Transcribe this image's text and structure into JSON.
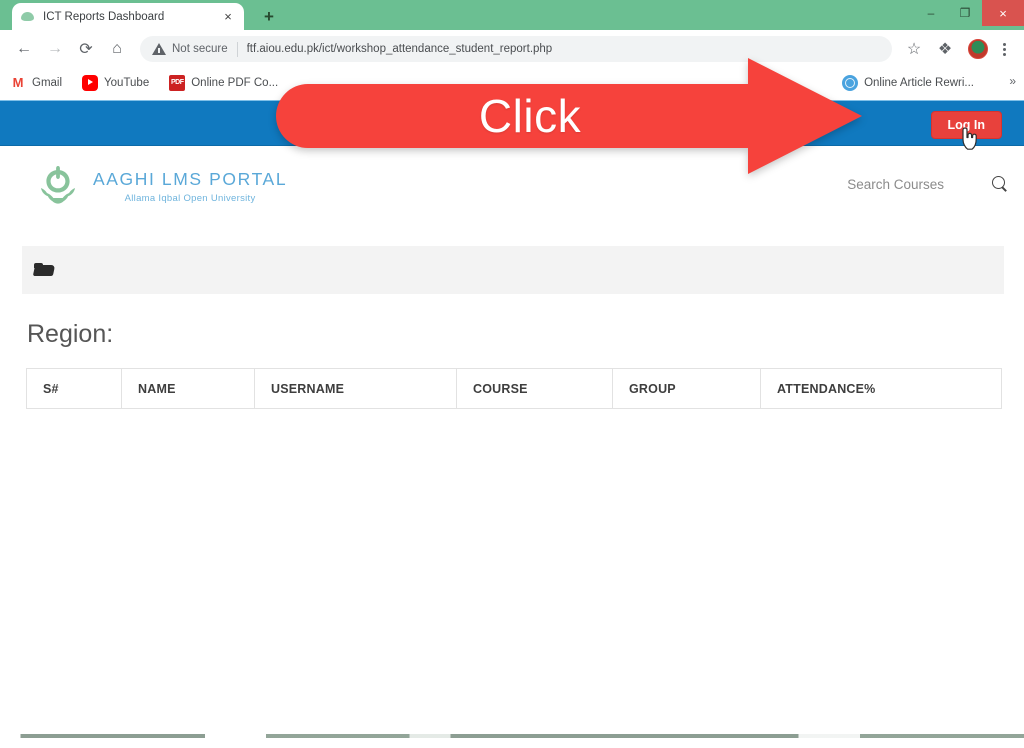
{
  "browser": {
    "tab": {
      "title": "ICT Reports Dashboard",
      "favicon": "aiou-leaf-icon",
      "close_label": "×"
    },
    "new_tab_label": "+",
    "window_controls": {
      "minimize": "–",
      "maximize": "❐",
      "close": "×"
    },
    "toolbar": {
      "back": "←",
      "forward": "→",
      "reload": "⟳",
      "home": "⌂",
      "security_label": "Not secure",
      "url": "ftf.aiou.edu.pk/ict/workshop_attendance_student_report.php",
      "bookmark_star": "☆",
      "extensions": "❖",
      "menu": "menu-icon"
    },
    "bookmarks": {
      "items": [
        {
          "label": "Gmail",
          "icon": "gmail-icon"
        },
        {
          "label": "YouTube",
          "icon": "youtube-icon"
        },
        {
          "label": "Online PDF Co...",
          "icon": "pdf-icon"
        },
        {
          "label": "Online Article Rewri...",
          "icon": "globe-icon"
        }
      ],
      "overflow": "»"
    }
  },
  "site": {
    "navbar": {
      "login_label": "Log In",
      "background_color": "#1079bf",
      "login_color": "#e8413c"
    },
    "brand": {
      "title": "AAGHI  LMS  PORTAL",
      "subtitle": "Allama Iqbal Open University",
      "logo": "aiou-crest-logo",
      "title_color": "#5aa8d8"
    },
    "search": {
      "label": "Search Courses",
      "icon": "search-icon"
    },
    "breadcrumb": {
      "icon": "open-folder-icon"
    },
    "region_heading": "Region:",
    "table": {
      "columns": [
        "S#",
        "NAME",
        "USERNAME",
        "COURSE",
        "GROUP",
        "ATTENDANCE%"
      ],
      "rows": []
    }
  },
  "annotation": {
    "text": "Click",
    "color": "#f6423c",
    "shape": "right-arrow"
  }
}
